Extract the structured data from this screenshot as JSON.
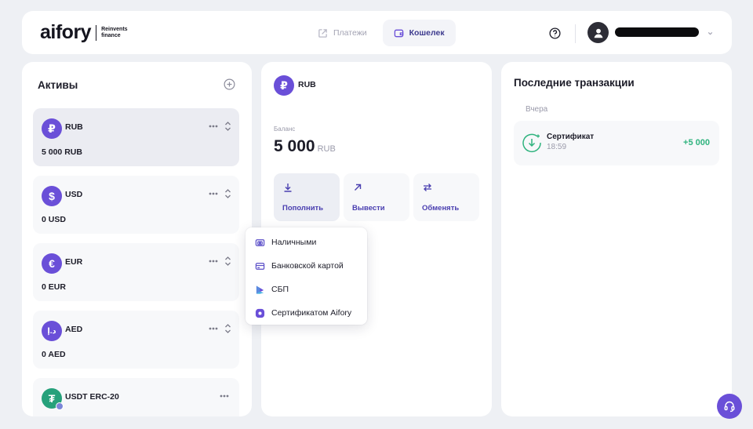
{
  "header": {
    "logo_word": "aifory",
    "logo_tagline": "Reinvents finance",
    "nav": [
      {
        "label": "Платежи",
        "icon": "arrow-up-right-icon"
      },
      {
        "label": "Кошелек",
        "icon": "wallet-icon"
      }
    ],
    "help_icon": "question-icon",
    "avatar_icon": "user-icon"
  },
  "assets": {
    "title": "Активы",
    "add_icon": "plus-circle-icon",
    "items": [
      {
        "symbol": "₽",
        "code": "RUB",
        "balance": "5 000  RUB"
      },
      {
        "symbol": "$",
        "code": "USD",
        "balance": "0  USD"
      },
      {
        "symbol": "€",
        "code": "EUR",
        "balance": "0  EUR"
      },
      {
        "symbol": "د.إ",
        "code": "AED",
        "balance": "0  AED"
      },
      {
        "symbol": "₮",
        "code": "USDT ERC-20",
        "balance": ""
      }
    ]
  },
  "wallet": {
    "currency_symbol": "₽",
    "currency": "RUB",
    "balance_label": "Баланс",
    "balance_value": "5 000",
    "balance_currency": "RUB",
    "actions": [
      {
        "label": "Пополнить",
        "icon": "download-icon"
      },
      {
        "label": "Вывести",
        "icon": "arrow-up-right-icon"
      },
      {
        "label": "Обменять",
        "icon": "swap-icon"
      }
    ]
  },
  "topup_menu": {
    "items": [
      {
        "label": "Наличными",
        "icon": "cash-icon"
      },
      {
        "label": "Банковской картой",
        "icon": "card-icon"
      },
      {
        "label": "СБП",
        "icon": "sbp-icon"
      },
      {
        "label": "Сертификатом Aifory",
        "icon": "certificate-icon"
      }
    ]
  },
  "transactions": {
    "title": "Последние транзакции",
    "groups": [
      {
        "day": "Вчера",
        "items": [
          {
            "name": "Сертификат",
            "time": "18:59",
            "amount": "+5 000"
          }
        ]
      }
    ]
  },
  "colors": {
    "accent": "#6a4fd8",
    "positive": "#2fb37e",
    "background": "#eef0f4"
  },
  "support_icon": "headset-icon"
}
